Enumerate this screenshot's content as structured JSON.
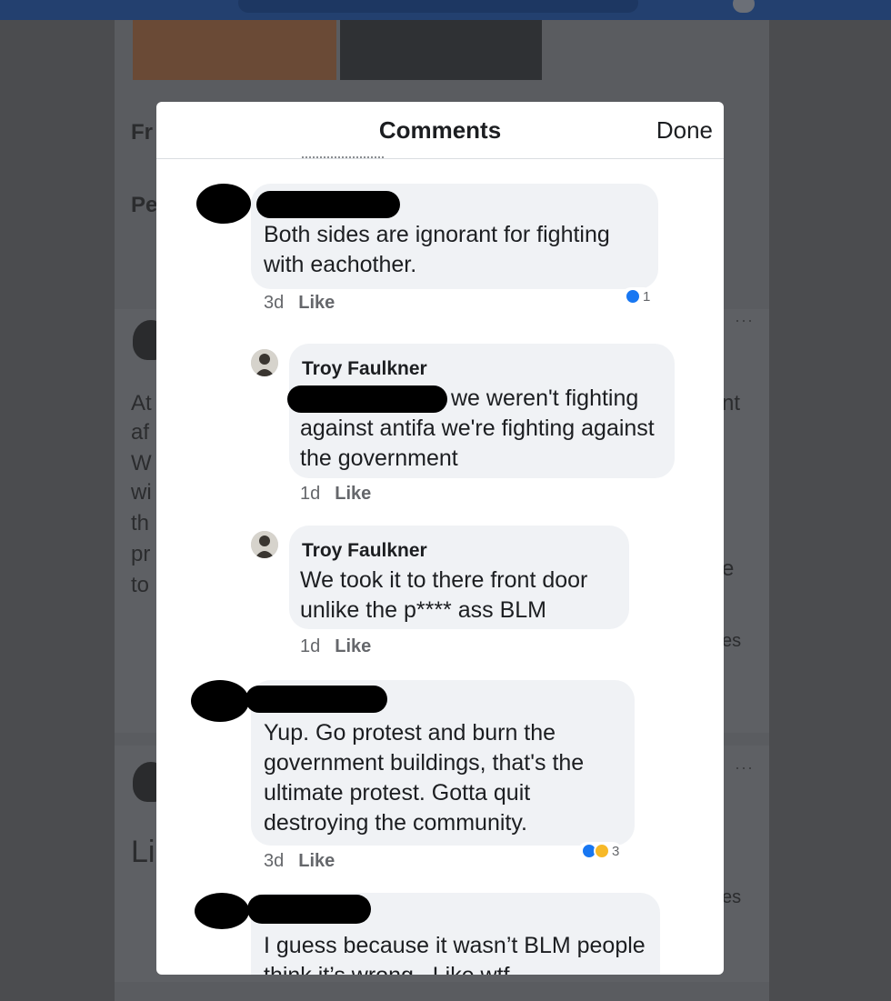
{
  "modal": {
    "title": "Comments",
    "done_label": "Done"
  },
  "background": {
    "heading_fragment": "Fr",
    "subheading_fragment": "Pe",
    "post_text_fragments": [
      "At",
      "af",
      "W",
      "wi",
      "th",
      "pr",
      "to"
    ],
    "right_fragments": [
      "nt",
      "e",
      "es",
      "es"
    ],
    "second_post_fragment": "Li",
    "more_dots": "···"
  },
  "comments": [
    {
      "author": "",
      "text": "Both sides are ignorant for fighting with eachother.",
      "time": "3d",
      "like_label": "Like",
      "reactions": {
        "types": [
          "like"
        ],
        "count": "1"
      }
    },
    {
      "author": "Troy Faulkner",
      "text": "we weren't fighting against antifa we're fighting against the government",
      "time": "1d",
      "like_label": "Like",
      "avatar_icon": "user-avatar-icon"
    },
    {
      "author": "Troy Faulkner",
      "text": "We took it to there front door unlike the p**** ass BLM",
      "time": "1d",
      "like_label": "Like",
      "avatar_icon": "user-avatar-icon"
    },
    {
      "author": "",
      "text": "Yup. Go protest and burn the government buildings, that's the ultimate protest. Gotta quit destroying the community.",
      "time": "3d",
      "like_label": "Like",
      "reactions": {
        "types": [
          "like",
          "care"
        ],
        "count": "3"
      }
    },
    {
      "author": "",
      "text": "I guess because it wasn’t BLM people think it’s wrong . Like wtf"
    }
  ],
  "colors": {
    "like_blue": "#1877f2",
    "bubble": "#f0f2f5",
    "backdrop": "#4b4c4f"
  }
}
